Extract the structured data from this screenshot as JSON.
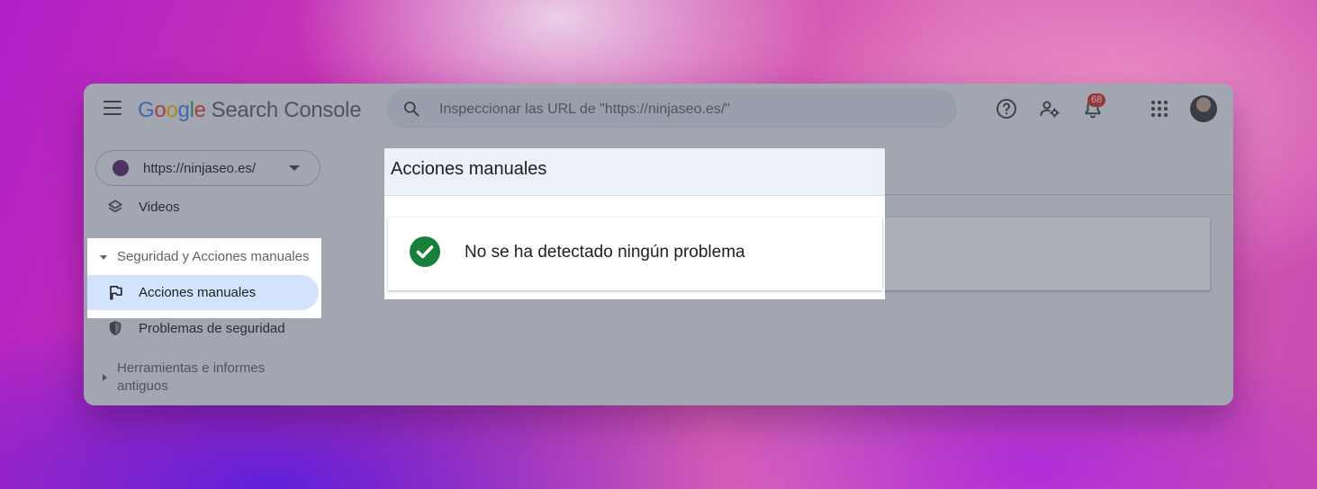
{
  "app": {
    "logo_letters": [
      "G",
      "o",
      "o",
      "g",
      "l",
      "e"
    ],
    "product": "Search Console"
  },
  "search": {
    "placeholder": "Inspeccionar las URL de \"https://ninjaseo.es/\""
  },
  "header_icons": [
    "help-icon",
    "manage-users-icon",
    "notifications-icon",
    "apps-grid-icon",
    "avatar"
  ],
  "notifications": {
    "count": "68"
  },
  "property": {
    "url": "https://ninjaseo.es/"
  },
  "sidebar": {
    "videos_label": "Videos",
    "security_section": "Seguridad y Acciones manuales",
    "manual_actions_label": "Acciones manuales",
    "security_issues_label": "Problemas de seguridad",
    "legacy_section_line1": "Herramientas e informes",
    "legacy_section_line2": "antiguos"
  },
  "main": {
    "page_title": "Acciones manuales",
    "status_message": "No se ha detectado ningún problema"
  },
  "colors": {
    "active_nav_bg": "#d3e3fd",
    "success_green": "#188038",
    "badge_red": "#d93025"
  }
}
